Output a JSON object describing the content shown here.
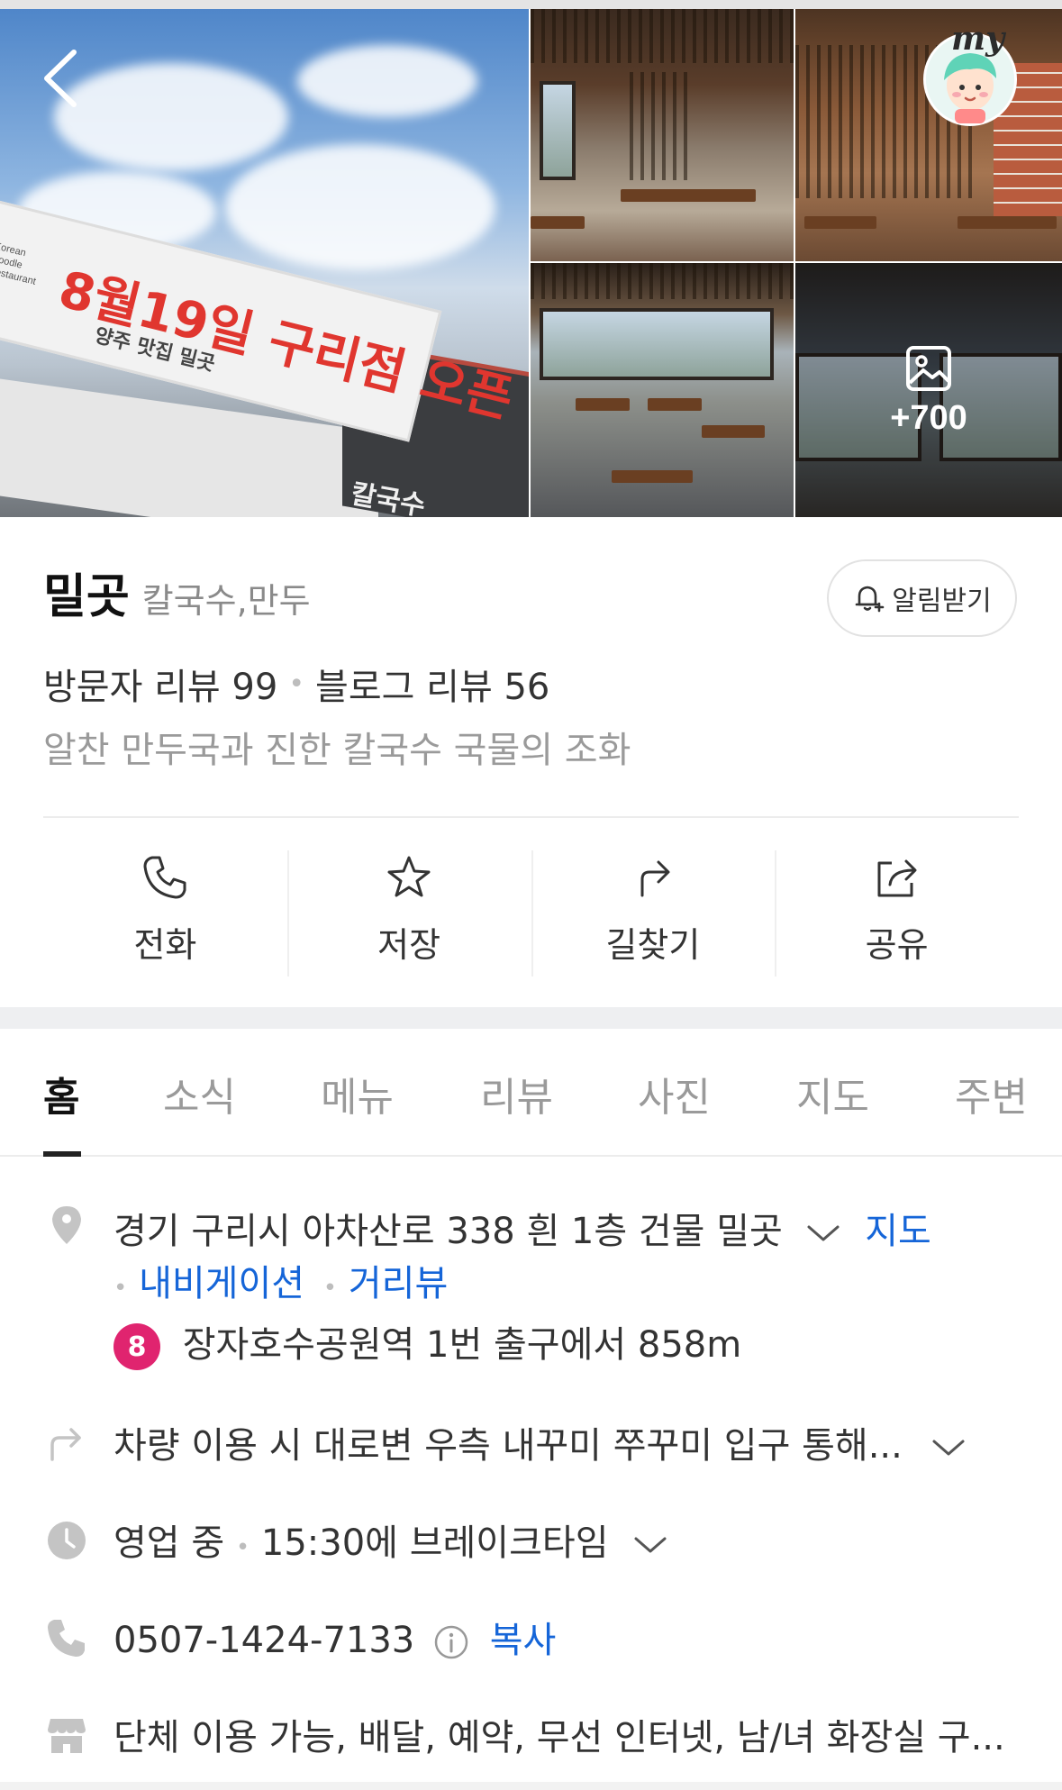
{
  "gallery": {
    "banner_text": "8월19일 구리점 오픈",
    "banner_sub": "양주 맛집 밀곳",
    "banner_tag": "Korean Noodle Restaurant",
    "building_sign": "칼국수",
    "more_count": "+700",
    "my_label": "my"
  },
  "place": {
    "name": "밀곳",
    "category": "칼국수,만두",
    "alarm_label": "알림받기",
    "visitor_review": "방문자 리뷰 99",
    "blog_review": "블로그 리뷰 56",
    "description": "알찬 만두국과 진한 칼국수 국물의 조화"
  },
  "actions": [
    {
      "label": "전화",
      "icon": "phone-icon"
    },
    {
      "label": "저장",
      "icon": "star-icon"
    },
    {
      "label": "길찾기",
      "icon": "directions-icon"
    },
    {
      "label": "공유",
      "icon": "share-icon"
    }
  ],
  "tabs": [
    "홈",
    "소식",
    "메뉴",
    "리뷰",
    "사진",
    "지도",
    "주변"
  ],
  "info": {
    "address": "경기 구리시 아차산로 338 흰 1층 건물 밀곳",
    "map_link": "지도",
    "navigation_link": "내비게이션",
    "streetview_link": "거리뷰",
    "subway_line": "8",
    "subway_text": "장자호수공원역 1번 출구에서 858m",
    "directions_text": "차량 이용 시 대로변 우측 내꾸미 쭈꾸미 입구 통해...",
    "status": "영업 중",
    "hours_text": "15:30에 브레이크타임",
    "phone": "0507-1424-7133",
    "copy_label": "복사",
    "amenities": "단체 이용 가능, 배달, 예약, 무선 인터넷, 남/녀 화장실 구..."
  },
  "colors": {
    "link": "#1565d8",
    "subway_line8": "#e0246f",
    "icon_gray": "#c4c4c4"
  }
}
